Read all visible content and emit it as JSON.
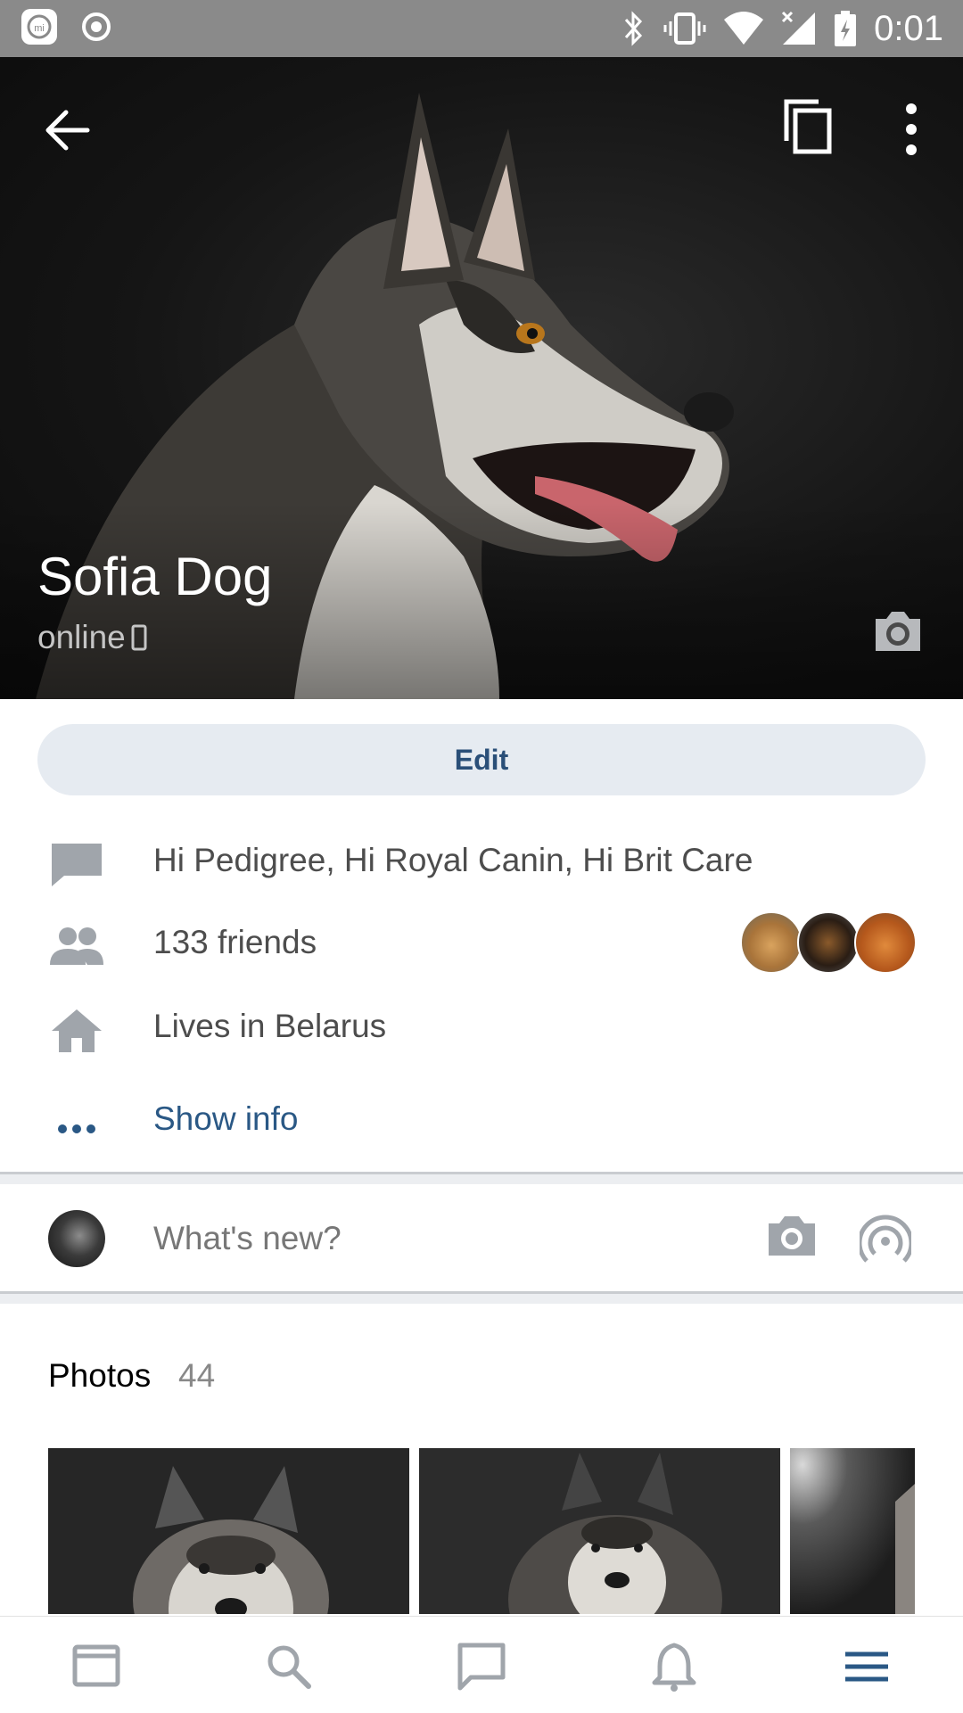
{
  "status_bar": {
    "time": "0:01"
  },
  "profile": {
    "name": "Sofia Dog",
    "status": "online"
  },
  "edit_label": "Edit",
  "info": {
    "status_text": "Hi Pedigree, Hi Royal Canin, Hi Brit Care",
    "friends": "133 friends",
    "location": "Lives in Belarus",
    "show_info": "Show info"
  },
  "composer": {
    "placeholder": "What's new?"
  },
  "photos": {
    "title": "Photos",
    "count": "44"
  },
  "colors": {
    "accent": "#2a5885",
    "edit_bg": "#e6ebf1",
    "icon_gray": "#a0a5ab"
  },
  "icons": {
    "nav": [
      "news-icon",
      "search-icon",
      "messages-icon",
      "notifications-icon",
      "menu-icon"
    ]
  }
}
